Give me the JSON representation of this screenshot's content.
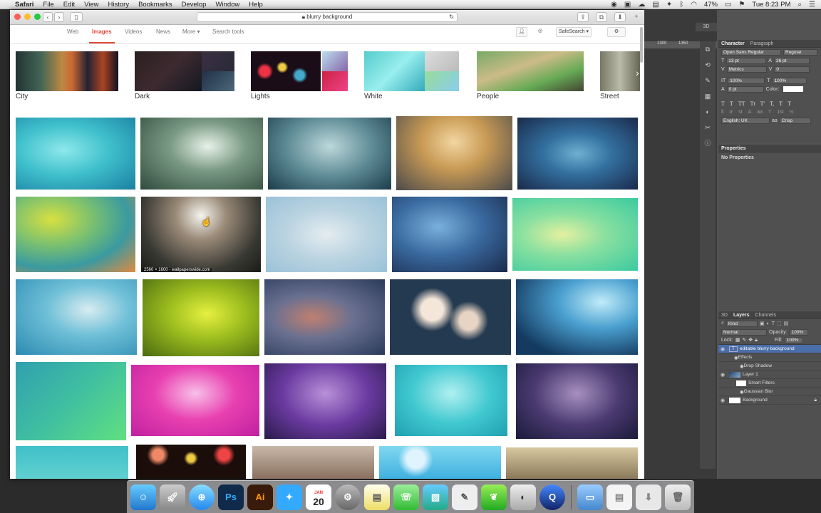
{
  "menubar": {
    "app": "Safari",
    "items": [
      "File",
      "Edit",
      "View",
      "History",
      "Bookmarks",
      "Develop",
      "Window",
      "Help"
    ],
    "battery": "47%",
    "clock": "Tue 8:23 PM"
  },
  "safari": {
    "address": "blurry background"
  },
  "google": {
    "tabs": [
      "Web",
      "Images",
      "Videos",
      "News",
      "More ▾",
      "Search tools"
    ],
    "active_tab": "Images",
    "safesearch": "SafeSearch ▾"
  },
  "chips": [
    {
      "label": "City"
    },
    {
      "label": "Dark"
    },
    {
      "label": "Lights"
    },
    {
      "label": "White"
    },
    {
      "label": "People"
    },
    {
      "label": "Street"
    }
  ],
  "results": {
    "hover_caption": "2560 × 1600 - wallpaperswide.com"
  },
  "photoshop": {
    "ruler_values": [
      "1300",
      "1350"
    ],
    "character_tabs": [
      "Character",
      "Paragraph"
    ],
    "font_family": "Open Sans Regular",
    "font_style": "Regular",
    "font_size": "13 pt",
    "leading": "26 pt",
    "kerning": "Metrics",
    "tracking": "0",
    "vscale": "100%",
    "hscale": "100%",
    "baseline": "0 pt",
    "color_label": "Color:",
    "language": "English: UK",
    "antialias": "Crisp",
    "properties_title": "Properties",
    "properties_empty": "No Properties",
    "layers_tabs": [
      "3D",
      "Layers",
      "Channels"
    ],
    "kind": "Kind",
    "blend": "Normal",
    "opacity_label": "Opacity:",
    "opacity": "100%",
    "lock_label": "Lock:",
    "fill_label": "Fill:",
    "fill": "100%",
    "layers": [
      {
        "name": "editable blurry background",
        "indent": 0,
        "selected": true
      },
      {
        "name": "Effects",
        "indent": 1,
        "selected": false
      },
      {
        "name": "Drop Shadow",
        "indent": 2,
        "selected": false
      },
      {
        "name": "Layer 1",
        "indent": 0,
        "selected": false
      },
      {
        "name": "Smart Filters",
        "indent": 1,
        "selected": false
      },
      {
        "name": "Gaussian Blur",
        "indent": 2,
        "selected": false
      },
      {
        "name": "Background",
        "indent": 0,
        "selected": false
      }
    ],
    "panel_3d_label": "3D"
  },
  "dock": {
    "calendar_month": "JAN",
    "calendar_day": "20",
    "ps_label": "Ps",
    "ai_label": "Ai"
  },
  "colors": {
    "google_red": "#dd4b39",
    "ps_panel": "#535353",
    "ps_selected": "#4a6ea9"
  }
}
